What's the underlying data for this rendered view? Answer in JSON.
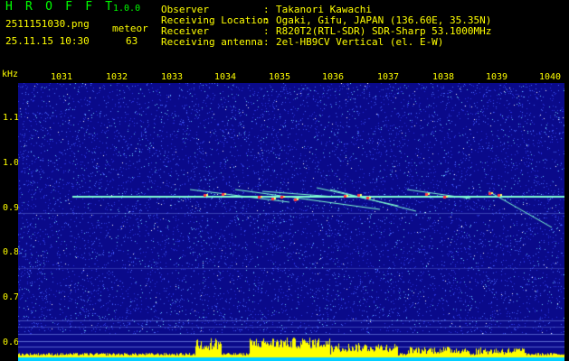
{
  "header": {
    "app_name": "H R O F F T",
    "version": "1.0.0",
    "filename": "2511151030.png",
    "meteor_label": "meteor",
    "datetime": "25.11.15 10:30",
    "meteor_count": "63"
  },
  "info": [
    {
      "key": "Observer",
      "value": "Takanori Kawachi"
    },
    {
      "key": "Receiving Location",
      "value": "Ogaki, Gifu, JAPAN (136.60E, 35.35N)"
    },
    {
      "key": "Receiver",
      "value": "R820T2(RTL-SDR) SDR-Sharp 53.1000MHz"
    },
    {
      "key": "Receiving antenna",
      "value": "2el-HB9CV Vertical (el. E-W)"
    }
  ],
  "plot": {
    "unit": "kHz",
    "x_ticks": [
      "1031",
      "1032",
      "1033",
      "1034",
      "1035",
      "1036",
      "1037",
      "1038",
      "1039",
      "1040"
    ],
    "y_ticks": [
      "1.1",
      "1.0",
      "0.9",
      "0.8",
      "0.7",
      "0.6"
    ],
    "colors": {
      "background": "#0a0a8a",
      "noise": "#3a4cff",
      "trace": "#7fffd4",
      "hot": "#ff3344",
      "spectrum": "#ffff00",
      "baseline": "#00d0ff"
    }
  }
}
